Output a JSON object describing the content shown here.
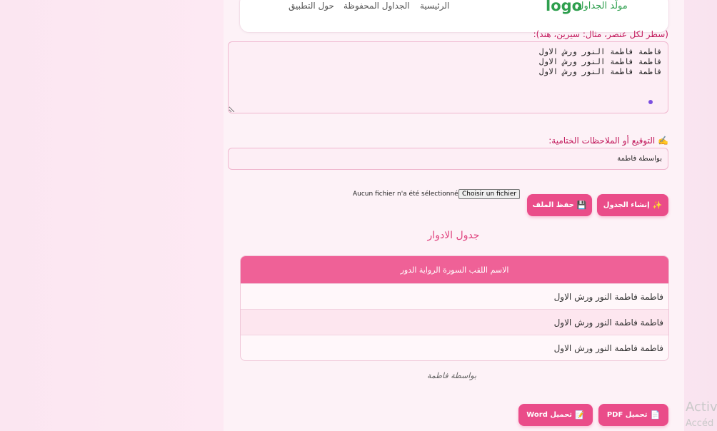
{
  "nav": {
    "logo": "logo",
    "brand": "مولّد الجداول",
    "links": [
      "الرئيسية",
      "الجداول المحفوظة",
      "حول التطبيق"
    ]
  },
  "items_label": "(سطر لكل عنصر، مثال: سيرين، هند):",
  "items_text": "فاطمة فاطمة النور ورش الاول\nفاطمة فاطمة النور ورش الاول\nفاطمة فاطمة النور ورش الاول",
  "signature": {
    "icon": "✍️",
    "label": "التوقيع أو الملاحظات الختامية:",
    "value": "بواسطة فاطمة"
  },
  "file": {
    "button": "Choisir un fichier",
    "status": "Aucun fichier n'a été sélectionné"
  },
  "actions": {
    "create_icon": "✨",
    "create": "إنشاء الجدول",
    "save_icon": "💾",
    "save": "حفظ الملف"
  },
  "table": {
    "title": "جدول الادوار",
    "header": "الاسم اللقب السورة الرواية الدور",
    "rows": [
      "فاطمة فاطمة النور ورش الاول",
      "فاطمة فاطمة النور ورش الاول",
      "فاطمة فاطمة النور ورش الاول"
    ]
  },
  "footnote": "بواسطة فاطمة",
  "downloads": {
    "pdf_icon": "📄",
    "pdf": "تحميل PDF",
    "word_icon": "📝",
    "word": "تحميل Word"
  },
  "watermark": {
    "line1": "Activ",
    "line2": "Accéd"
  },
  "colors": {
    "accent": "#ea4c89",
    "logo": "#2e9f4e",
    "header": "#ef6197"
  }
}
